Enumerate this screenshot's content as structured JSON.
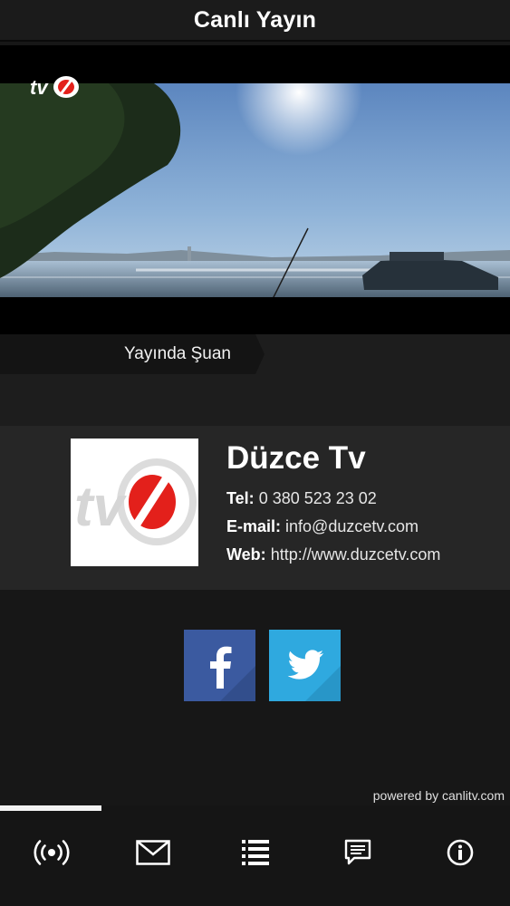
{
  "header": {
    "title": "Canlı Yayın"
  },
  "video": {
    "watermark_icon": "tv-logo-icon"
  },
  "now": {
    "label": "Yayında Şuan"
  },
  "channel": {
    "name": "Düzce Tv",
    "tel_label": "Tel:",
    "tel": "0 380 523 23 02",
    "email_label": "E-mail:",
    "email": "info@duzcetv.com",
    "web_label": "Web:",
    "web": "http://www.duzcetv.com"
  },
  "social": {
    "facebook_icon": "facebook-icon",
    "twitter_icon": "twitter-icon"
  },
  "footer": {
    "powered": "powered by canlitv.com"
  },
  "bottom_nav": {
    "items": [
      "broadcast-icon",
      "mail-icon",
      "list-icon",
      "chat-icon",
      "info-icon"
    ],
    "active_index": 0
  },
  "colors": {
    "facebook": "#3b5aa0",
    "twitter": "#2fa9df",
    "brand_red": "#e3201b",
    "background": "#171717"
  }
}
